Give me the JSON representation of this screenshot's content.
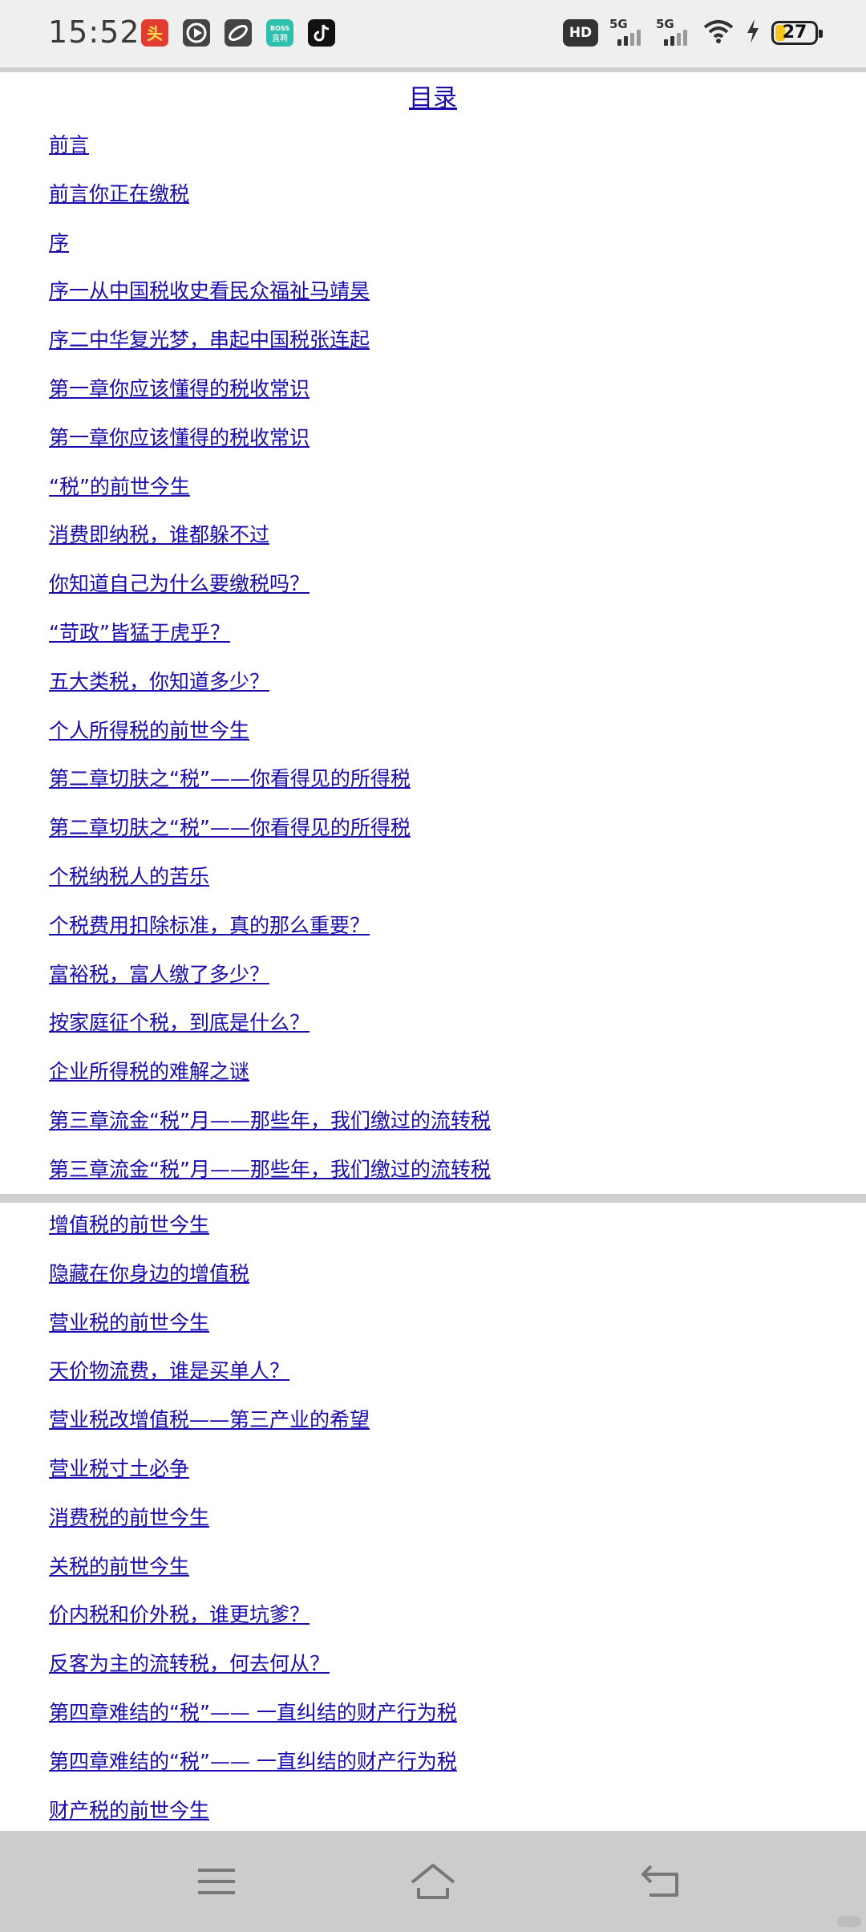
{
  "status_bar": {
    "time": "15:52",
    "notifications": [
      {
        "icon": "news-app-icon",
        "color": "#e03c31"
      },
      {
        "icon": "video-player-icon",
        "color": "#444444"
      },
      {
        "icon": "browser-app-icon",
        "color": "#444444"
      },
      {
        "icon": "boss-zhipin-icon",
        "color": "#2fbfad"
      },
      {
        "icon": "tiktok-icon",
        "color": "#111111"
      }
    ],
    "hd_label": "HD",
    "network_1": "5G",
    "network_2": "5G",
    "battery_level": "27"
  },
  "page": {
    "title": "目录"
  },
  "toc_top": [
    "前言",
    "前言你正在缴税",
    "序",
    "序一从中国税收史看民众福祉马靖昊",
    "序二中华复光梦，串起中国税张连起",
    "第一章你应该懂得的税收常识",
    "第一章你应该懂得的税收常识",
    "“税”的前世今生",
    "消费即纳税，谁都躲不过",
    "你知道自己为什么要缴税吗？",
    "“苛政”皆猛于虎乎？",
    "五大类税，你知道多少？",
    "个人所得税的前世今生",
    "第二章切肤之“税”——你看得见的所得税",
    "第二章切肤之“税”——你看得见的所得税",
    "个税纳税人的苦乐",
    "个税费用扣除标准，真的那么重要？",
    "富裕税，富人缴了多少？",
    "按家庭征个税，到底是什么？",
    "企业所得税的难解之谜",
    "第三章流金“税”月——那些年，我们缴过的流转税",
    "第三章流金“税”月——那些年，我们缴过的流转税"
  ],
  "toc_bottom": [
    "增值税的前世今生",
    "隐藏在你身边的增值税",
    "营业税的前世今生",
    "天价物流费，谁是买单人？",
    "营业税改增值税——第三产业的希望",
    "营业税寸土必争",
    "消费税的前世今生",
    "关税的前世今生",
    "价内税和价外税，谁更坑爹？",
    "反客为主的流转税，何去何从？",
    "第四章难结的“税”—— 一直纠结的财产行为税",
    "第四章难结的“税”—— 一直纠结的财产行为税",
    "财产税的前世今生"
  ],
  "nav_bar": {
    "buttons": [
      "menu-icon",
      "home-icon",
      "back-icon"
    ]
  },
  "colors": {
    "link": "#1a0dab",
    "status_bg": "#efefef",
    "nav_bg": "#cccccc",
    "battery_fill": "#f5c518"
  }
}
